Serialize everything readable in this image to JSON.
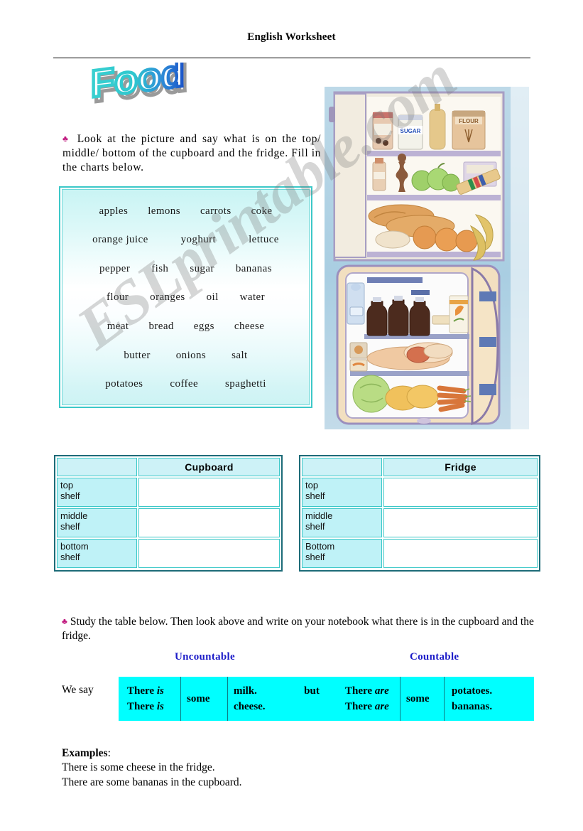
{
  "header": {
    "title": "English Worksheet"
  },
  "title_art": {
    "text": "Food"
  },
  "instructions": {
    "bullet_glyph": "♣",
    "task1": "Look at the picture and say what is on the top/ middle/ bottom of the cupboard and the fridge. Fill in the charts below.",
    "task2": "Study the table below. Then look above and write on your notebook what there is in the cupboard and the fridge."
  },
  "word_bank": {
    "rows": [
      [
        "apples",
        "lemons",
        "carrots",
        "coke"
      ],
      [
        "orange juice",
        "yoghurt",
        "lettuce"
      ],
      [
        "pepper",
        "fish",
        "sugar",
        "bananas"
      ],
      [
        "flour",
        "oranges",
        "oil",
        "water"
      ],
      [
        "meat",
        "bread",
        "eggs",
        "cheese"
      ],
      [
        "butter",
        "onions",
        "salt"
      ],
      [
        "potatoes",
        "coffee",
        "spaghetti"
      ]
    ]
  },
  "illustration": {
    "alt": "Watercolour drawing of an open cupboard above an open fridge filled with food",
    "cupboard_items": [
      "jam jar",
      "sugar jar",
      "oil bottle",
      "flour jar",
      "bottle",
      "pepper mill",
      "apples",
      "biscuits",
      "bread",
      "oranges",
      "bananas"
    ],
    "fridge_items": [
      "water bottle",
      "coke bottles",
      "juice carton",
      "butter",
      "meat",
      "lettuce",
      "onions",
      "carrots"
    ]
  },
  "tables": {
    "cupboard": {
      "title": "Cupboard",
      "rows": [
        {
          "label_line1": "top",
          "label_line2": "shelf",
          "answer": ""
        },
        {
          "label_line1": "middle",
          "label_line2": "shelf",
          "answer": ""
        },
        {
          "label_line1": "bottom",
          "label_line2": "shelf",
          "answer": ""
        }
      ]
    },
    "fridge": {
      "title": "Fridge",
      "rows": [
        {
          "label_line1": "top",
          "label_line2": "shelf",
          "answer": ""
        },
        {
          "label_line1": "middle",
          "label_line2": "shelf",
          "answer": ""
        },
        {
          "label_line1": "Bottom",
          "label_line2": "shelf",
          "answer": ""
        }
      ]
    }
  },
  "grammar": {
    "column_headers": {
      "uncountable": "Uncountable",
      "countable": "Countable"
    },
    "lead_label": "We say",
    "uncountable": {
      "subject_line1_plain": "There ",
      "subject_line1_italic": "is",
      "subject_line2_plain": "There ",
      "subject_line2_italic": "is",
      "quantifier": "some",
      "noun_line1": "milk.",
      "noun_line2": "cheese."
    },
    "conjunction": "but",
    "countable": {
      "subject_line1_plain": "There ",
      "subject_line1_italic": "are",
      "subject_line2_plain": "There ",
      "subject_line2_italic": "are",
      "quantifier": "some",
      "noun_line1": "potatoes.",
      "noun_line2": "bananas."
    }
  },
  "examples": {
    "heading": "Examples",
    "heading_colon": ":",
    "lines": [
      "There is some cheese in the fridge.",
      "There are some bananas in the cupboard."
    ]
  },
  "watermark": {
    "text": "ESLprintable.com"
  },
  "colors": {
    "border_teal": "#3cc8c8",
    "table_border_dark": "#1d6b78",
    "label_cyan": "#bff2f7",
    "grammar_cyan": "#00ffff",
    "header_blue": "#1c1cc8",
    "clover_magenta": "#c0197f"
  }
}
